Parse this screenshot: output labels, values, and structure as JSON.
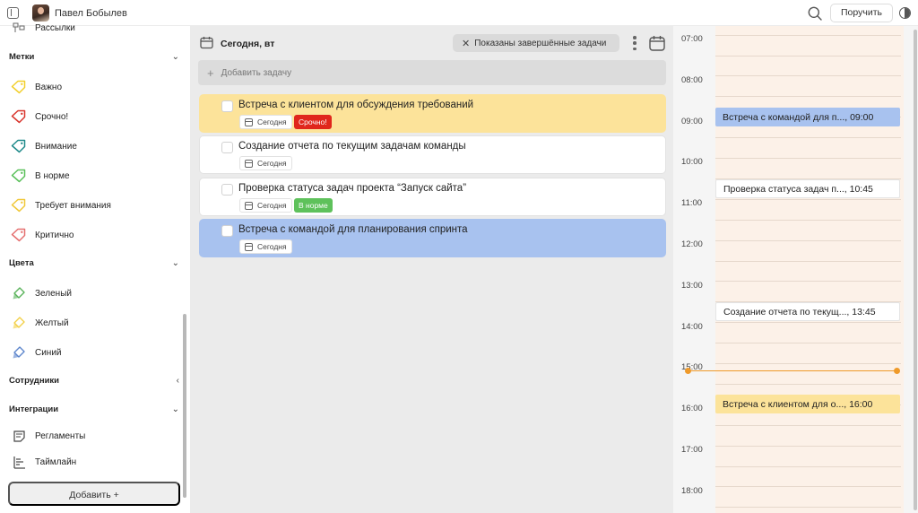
{
  "header": {
    "user_name": "Павел Бобылев",
    "assign_label": "Поручить"
  },
  "sidebar": {
    "top_item": "Рассылки",
    "labels_title": "Метки",
    "labels": [
      {
        "label": "Важно",
        "color": "#f2cf2c"
      },
      {
        "label": "Срочно!",
        "color": "#d9362e"
      },
      {
        "label": "Внимание",
        "color": "#1f8a8a"
      },
      {
        "label": "В норме",
        "color": "#5ac05a"
      },
      {
        "label": "Требует внимания",
        "color": "#f0c83a"
      },
      {
        "label": "Критично",
        "color": "#e57070"
      }
    ],
    "colors_title": "Цвета",
    "colors": [
      {
        "label": "Зеленый",
        "color": "#59b35a"
      },
      {
        "label": "Желтый",
        "color": "#f2d04a"
      },
      {
        "label": "Синий",
        "color": "#5d86cc"
      }
    ],
    "employees_title": "Сотрудники",
    "integrations_title": "Интеграции",
    "integrations": [
      {
        "label": "Регламенты",
        "icon": "document-icon"
      },
      {
        "label": "Таймлайн",
        "icon": "timeline-icon"
      }
    ],
    "add_label": "Добавить +"
  },
  "tasks": {
    "title": "Сегодня, вт",
    "filter_label": "Показаны завершённые задачи",
    "add_placeholder": "Добавить задачу",
    "items": [
      {
        "title": "Встреча с клиентом для обсуждения требований",
        "date": "Сегодня",
        "tag": "Срочно!",
        "tag_color": "#e0261c",
        "bg": "#fce39a"
      },
      {
        "title": "Создание отчета по текущим задачам команды",
        "date": "Сегодня",
        "tag": "",
        "tag_color": "",
        "bg": "#ffffff"
      },
      {
        "title": "Проверка статуса задач проекта “Запуск сайта”",
        "date": "Сегодня",
        "tag": "В норме",
        "tag_color": "#5ec15b",
        "bg": "#ffffff"
      },
      {
        "title": "Встреча с командой для планирования спринта",
        "date": "Сегодня",
        "tag": "",
        "tag_color": "",
        "bg": "#a8c2ef"
      }
    ]
  },
  "calendar": {
    "hours": [
      "07:00",
      "08:00",
      "09:00",
      "10:00",
      "11:00",
      "12:00",
      "13:00",
      "14:00",
      "15:00",
      "16:00",
      "17:00",
      "18:00"
    ],
    "events": [
      {
        "text": "Встреча с командой для п..., 09:00",
        "bg": "#a8c2ef"
      },
      {
        "text": "Проверка статуса задач п..., 10:45",
        "bg": "#ffffff"
      },
      {
        "text": "Создание отчета по текущ..., 13:45",
        "bg": "#ffffff"
      },
      {
        "text": "Встреча с клиентом для о..., 16:00",
        "bg": "#fce39a"
      }
    ],
    "now_color": "#ef9a2a"
  }
}
